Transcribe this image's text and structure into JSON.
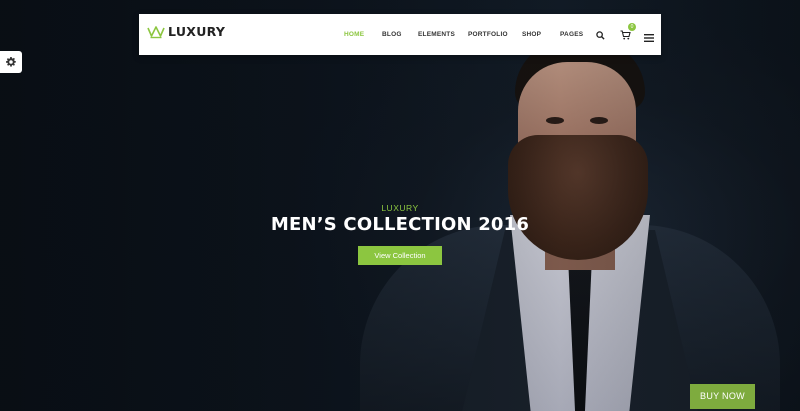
{
  "brand": {
    "name": "LUXURY",
    "accent": "#8cc640"
  },
  "nav": {
    "items": [
      {
        "label": "HOME",
        "active": true
      },
      {
        "label": "BLOG",
        "active": false
      },
      {
        "label": "ELEMENTS",
        "active": false
      },
      {
        "label": "PORTFOLIO",
        "active": false
      },
      {
        "label": "SHOP",
        "active": false
      },
      {
        "label": "PAGES",
        "active": false
      }
    ],
    "icons": [
      "search-icon",
      "cart-icon",
      "menu-icon"
    ],
    "cart_count": "0"
  },
  "settings": {
    "icon": "gear-icon"
  },
  "hero": {
    "eyebrow": "LUXURY",
    "headline": "MEN’S COLLECTION 2016",
    "cta_label": "View Collection"
  },
  "buy_now": {
    "label": "BUY NOW",
    "color": "#7eab3e"
  }
}
